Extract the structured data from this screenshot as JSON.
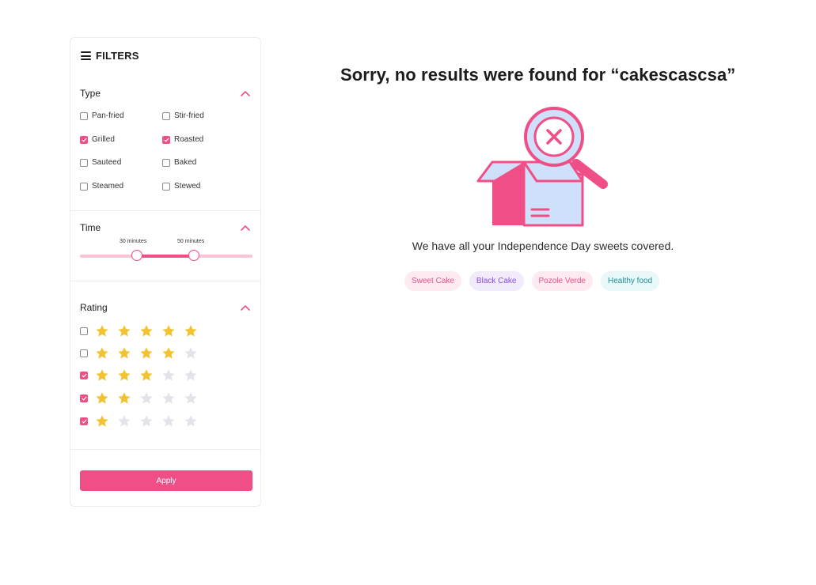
{
  "filters": {
    "title": "FILTERS",
    "type": {
      "title": "Type",
      "options": [
        {
          "label": "Pan-fried",
          "checked": false
        },
        {
          "label": "Stir-fried",
          "checked": false
        },
        {
          "label": "Grilled",
          "checked": true
        },
        {
          "label": "Roasted",
          "checked": true
        },
        {
          "label": "Sauteed",
          "checked": false
        },
        {
          "label": "Baked",
          "checked": false
        },
        {
          "label": "Steamed",
          "checked": false
        },
        {
          "label": "Stewed",
          "checked": false
        }
      ]
    },
    "time": {
      "title": "Time",
      "min_label": "30 minutes",
      "max_label": "50 minutes",
      "range_fraction": [
        0.33,
        0.66
      ]
    },
    "rating": {
      "title": "Rating",
      "rows": [
        {
          "stars": 5,
          "checked": false
        },
        {
          "stars": 4,
          "checked": false
        },
        {
          "stars": 3,
          "checked": true
        },
        {
          "stars": 2,
          "checked": true
        },
        {
          "stars": 1,
          "checked": true
        }
      ]
    },
    "apply_label": "Apply"
  },
  "results": {
    "headline": "Sorry, no results were found for “cakescascsa”",
    "subtext": "We have all your Independence Day sweets covered.",
    "suggestions": [
      {
        "label": "Sweet Cake",
        "color": "#f04e86",
        "bg": "#fdebf1"
      },
      {
        "label": "Black Cake",
        "color": "#8a4de8",
        "bg": "#f1ebfc"
      },
      {
        "label": "Pozole Verde",
        "color": "#f04e86",
        "bg": "#fdebf1"
      },
      {
        "label": "Healthy food",
        "color": "#1f8f98",
        "bg": "#e8f8f9"
      }
    ]
  },
  "colors": {
    "accent": "#f04e86",
    "star_on": "#f2c230",
    "star_off": "#e3e4ea"
  }
}
